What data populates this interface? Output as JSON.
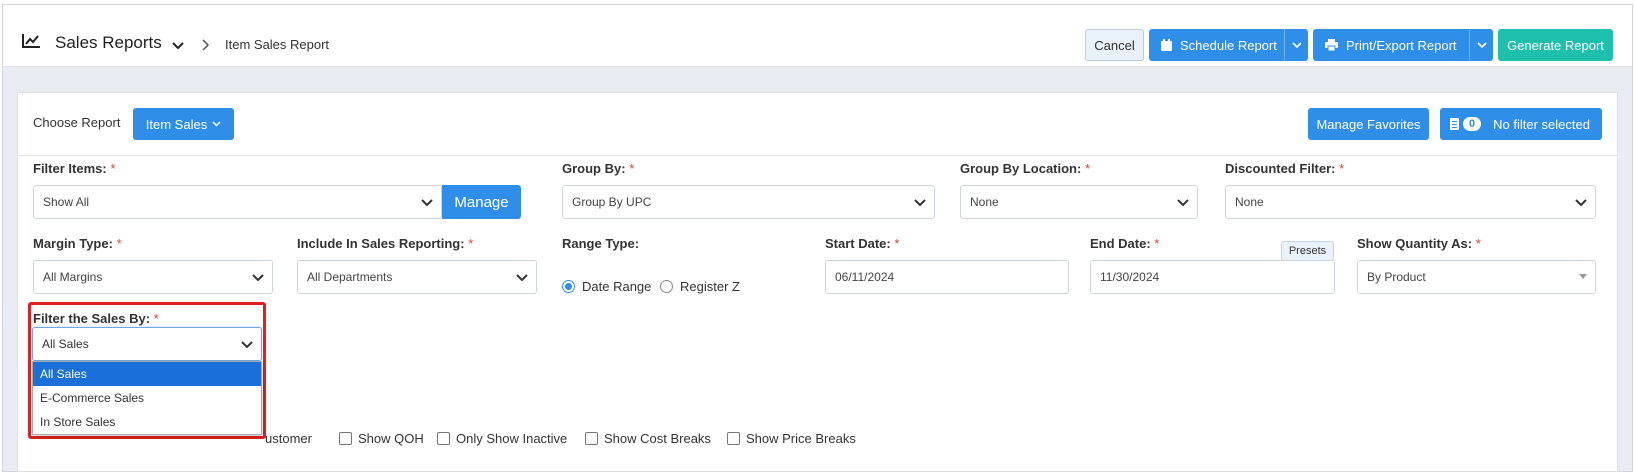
{
  "topbar": {
    "title": "Sales Reports",
    "breadcrumb": "Item Sales Report",
    "icons": {
      "title": "line-chart-icon",
      "dropdown": "chevron-down-icon",
      "separator": "chevron-right-icon"
    }
  },
  "actions": {
    "cancel": "Cancel",
    "schedule": "Schedule Report",
    "print_export": "Print/Export Report",
    "generate": "Generate Report",
    "icons": {
      "schedule": "calendar-icon",
      "print": "printer-icon"
    }
  },
  "report_chooser": {
    "label": "Choose Report",
    "selected": "Item Sales",
    "manage_favorites": "Manage Favorites",
    "filter_count": "0",
    "filter_status": "No filter selected",
    "filter_icon": "list-icon"
  },
  "filters": {
    "filter_items": {
      "label": "Filter Items:",
      "value": "Show All",
      "button": "Manage"
    },
    "group_by": {
      "label": "Group By:",
      "value": "Group By UPC"
    },
    "group_by_location": {
      "label": "Group By Location:",
      "value": "None"
    },
    "discounted_filter": {
      "label": "Discounted Filter:",
      "value": "None"
    },
    "margin_type": {
      "label": "Margin Type:",
      "value": "All Margins"
    },
    "include_in_sales": {
      "label": "Include In Sales Reporting:",
      "value": "All Departments"
    },
    "range_type": {
      "label": "Range Type:",
      "options": [
        "Date Range",
        "Register Z"
      ],
      "selected": "Date Range"
    },
    "start_date": {
      "label": "Start Date:",
      "value": "06/11/2024"
    },
    "end_date": {
      "label": "End Date:",
      "value": "11/30/2024",
      "presets": "Presets"
    },
    "show_quantity": {
      "label": "Show Quantity As:",
      "value": "By Product"
    },
    "filter_sales_by": {
      "label": "Filter the Sales By:",
      "value": "All Sales",
      "options": [
        "All Sales",
        "E-Commerce Sales",
        "In Store Sales"
      ]
    },
    "required_mark": "*"
  },
  "checkboxes": {
    "customer_partial": "ustomer",
    "show_qoh": "Show QOH",
    "only_inactive": "Only Show Inactive",
    "cost_breaks": "Show Cost Breaks",
    "price_breaks": "Show Price Breaks"
  },
  "colors": {
    "primary": "#2f8ee8",
    "teal": "#1fbfae",
    "required": "#e53935",
    "highlight": "#e02020",
    "selected_option": "#1a6fd9"
  }
}
